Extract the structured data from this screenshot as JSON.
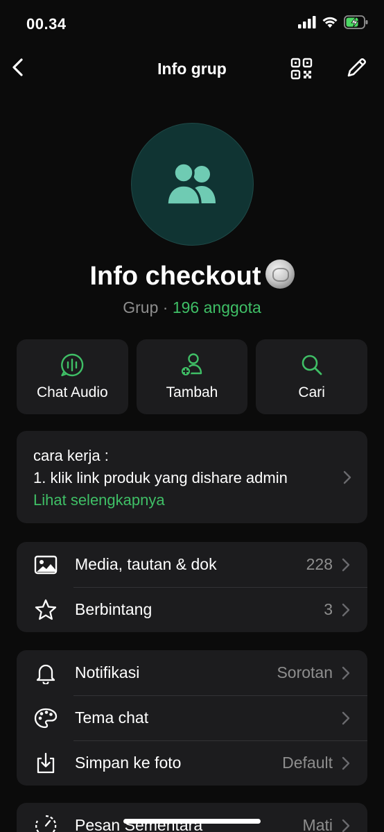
{
  "status": {
    "time": "00.34"
  },
  "nav": {
    "title": "Info grup"
  },
  "group": {
    "name": "Info checkout",
    "type": "Grup",
    "separator": " · ",
    "members": "196 anggota"
  },
  "actions": [
    {
      "label": "Chat Audio",
      "icon": "audio-chat-icon"
    },
    {
      "label": "Tambah",
      "icon": "add-member-icon"
    },
    {
      "label": "Cari",
      "icon": "search-icon"
    }
  ],
  "description": {
    "line1": "cara kerja :",
    "line2": "1. klik link produk yang dishare admin",
    "more": "Lihat selengkapnya"
  },
  "media_section": [
    {
      "label": "Media, tautan & dok",
      "value": "228",
      "icon": "image-icon"
    },
    {
      "label": "Berbintang",
      "value": "3",
      "icon": "star-icon"
    }
  ],
  "settings_section": [
    {
      "label": "Notifikasi",
      "value": "Sorotan",
      "icon": "bell-icon"
    },
    {
      "label": "Tema chat",
      "value": "",
      "icon": "palette-icon"
    },
    {
      "label": "Simpan ke foto",
      "value": "Default",
      "icon": "download-icon"
    }
  ],
  "disappearing": {
    "label": "Pesan Sementara",
    "value": "Mati",
    "icon": "timer-icon"
  },
  "colors": {
    "accent": "#3fbf66",
    "avatar_bg": "#103433",
    "avatar_fg": "#6fcbb3",
    "card": "#1c1c1e",
    "background": "#0b0b0b"
  }
}
